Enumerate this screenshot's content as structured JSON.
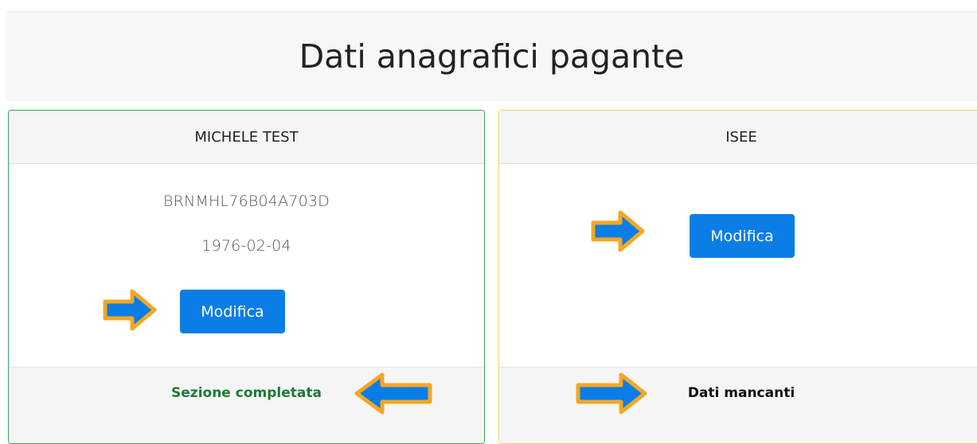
{
  "page": {
    "title": "Dati anagrafici pagante"
  },
  "left_card": {
    "header": "MICHELE TEST",
    "fiscal_code": "BRNMHL76B04A703D",
    "birth_date": "1976-02-04",
    "button_label": "Modifica",
    "status": "Sezione completata",
    "border_color": "#41a35a",
    "status_color": "#1e7a32"
  },
  "right_card": {
    "header": "ISEE",
    "button_label": "Modifica",
    "status": "Dati mancanti",
    "border_color": "#f2d365"
  },
  "annotations": {
    "arrow_fill": "#0b7de6",
    "arrow_outline": "#f5a623",
    "icon": "arrow-icon"
  },
  "colors": {
    "primary_button": "#0b7de6"
  }
}
